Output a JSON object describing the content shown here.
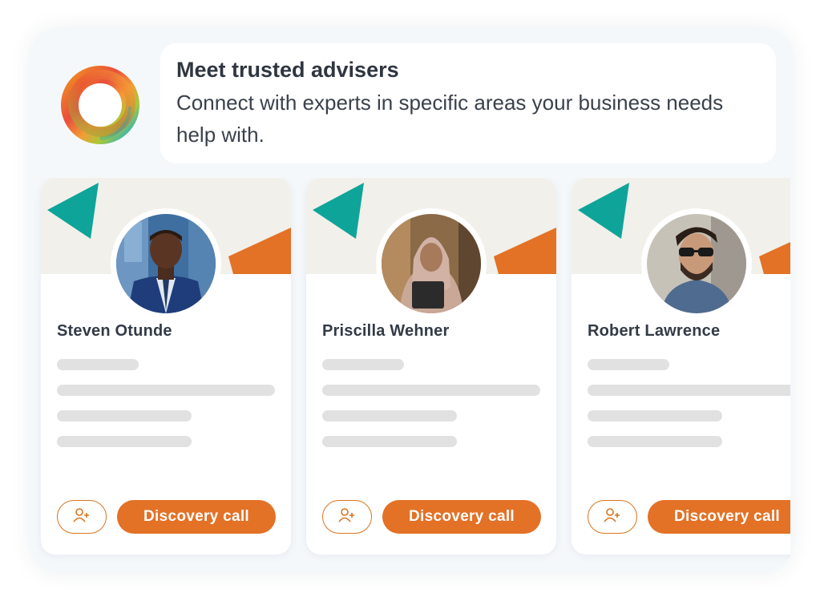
{
  "header": {
    "title": "Meet trusted advisers",
    "subtitle": "Connect with experts in specific areas your business needs help with."
  },
  "colors": {
    "accent_orange": "#e37126",
    "accent_teal": "#0fa49a",
    "banner_bg": "#f2f0ea",
    "skeleton": "#e1e1e1"
  },
  "logo": {
    "icon": "ring-logo-icon"
  },
  "advisers": [
    {
      "name": "Steven Otunde",
      "avatar_icon": "adviser-photo-icon",
      "add_icon": "add-user-icon",
      "call_label": "Discovery call"
    },
    {
      "name": "Priscilla Wehner",
      "avatar_icon": "adviser-photo-icon",
      "add_icon": "add-user-icon",
      "call_label": "Discovery call"
    },
    {
      "name": "Robert Lawrence",
      "avatar_icon": "adviser-photo-icon",
      "add_icon": "add-user-icon",
      "call_label": "Discovery call"
    }
  ]
}
